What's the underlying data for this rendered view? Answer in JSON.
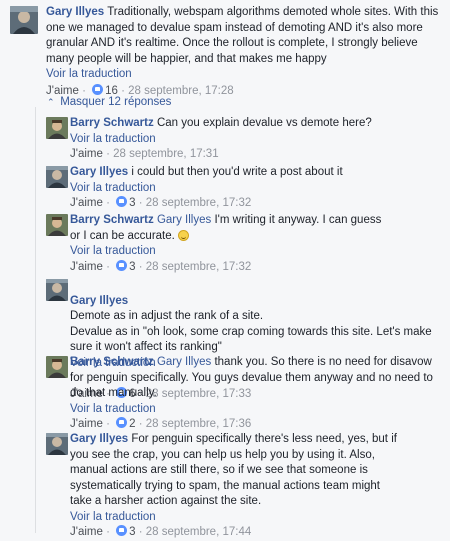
{
  "main_comment": {
    "author": "Gary Illyes",
    "text": "Traditionally, webspam algorithms demoted whole sites. With this one we managed to devalue spam instead of demoting AND it's also more granular AND it's realtime. Once the rollout is complete, I strongly believe many people will be happier, and that makes me happy",
    "translate": "Voir la traduction",
    "like": "J'aime",
    "reactions": "16",
    "time": "28 septembre, 17:28"
  },
  "hide_replies": {
    "label": "Masquer 12 réponses",
    "icon": "chevron-up-icon"
  },
  "replies": [
    {
      "author": "Barry Schwartz",
      "mention": "",
      "text": "Can you explain devalue vs demote here?",
      "translate": "Voir la traduction",
      "like": "J'aime",
      "reactions": "",
      "time": "28 septembre, 17:31"
    },
    {
      "author": "Gary Illyes",
      "mention": "",
      "text": "i could but then you'd write a post about it",
      "translate": "Voir la traduction",
      "like": "J'aime",
      "reactions": "3",
      "time": "28 septembre, 17:32"
    },
    {
      "author": "Barry Schwartz",
      "mention": "Gary Illyes",
      "text": "I'm writing it anyway. I can guess or I can be accurate.",
      "translate": "Voir la traduction",
      "like": "J'aime",
      "reactions": "3",
      "time": "28 septembre, 17:32",
      "emoji": "smile-emoji"
    },
    {
      "author": "Gary Illyes",
      "mention": "",
      "text": "Demote as in adjust the rank of a site.\nDevalue as in \"oh look, some crap coming towards this site. Let's make sure it won't affect its ranking\"",
      "translate": "Voir la traduction",
      "like": "J'aime",
      "reactions": "6",
      "time": "28 septembre, 17:33"
    },
    {
      "author": "Barry Schwartz",
      "mention": "Gary Illyes",
      "text": "thank you. So there is no need for disavow for penguin specifically. You guys devalue them anyway and no need to do that manually.",
      "translate": "Voir la traduction",
      "like": "J'aime",
      "reactions": "2",
      "time": "28 septembre, 17:36"
    },
    {
      "author": "Gary Illyes",
      "mention": "",
      "text": "For penguin specifically there's less need, yes, but if you see the crap, you can help us help you by using it. Also, manual actions are still there, so if we see that someone is systematically trying to spam, the manual actions team might take a harsher action against the site.",
      "translate": "Voir la traduction",
      "like": "J'aime",
      "reactions": "3",
      "time": "28 septembre, 17:44"
    }
  ],
  "colors": {
    "link": "#365899",
    "meta": "#90949c",
    "reaction": "#5890ff",
    "background": "#f6f7f9"
  }
}
